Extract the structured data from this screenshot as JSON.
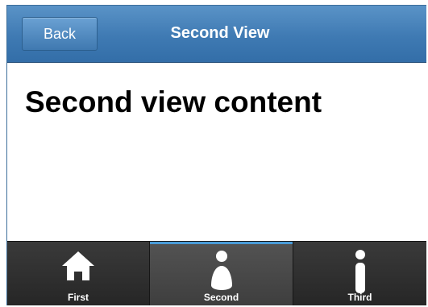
{
  "header": {
    "back_label": "Back",
    "title": "Second View"
  },
  "content": {
    "heading": "Second view content"
  },
  "tabbar": {
    "tabs": [
      {
        "label": "First",
        "icon": "home-icon",
        "active": false
      },
      {
        "label": "Second",
        "icon": "person-icon",
        "active": true
      },
      {
        "label": "Third",
        "icon": "info-icon",
        "active": false
      }
    ]
  },
  "colors": {
    "header": "#3f7ab3",
    "tabbar": "#2d2d2d",
    "active_indicator": "#4a9cd8"
  }
}
